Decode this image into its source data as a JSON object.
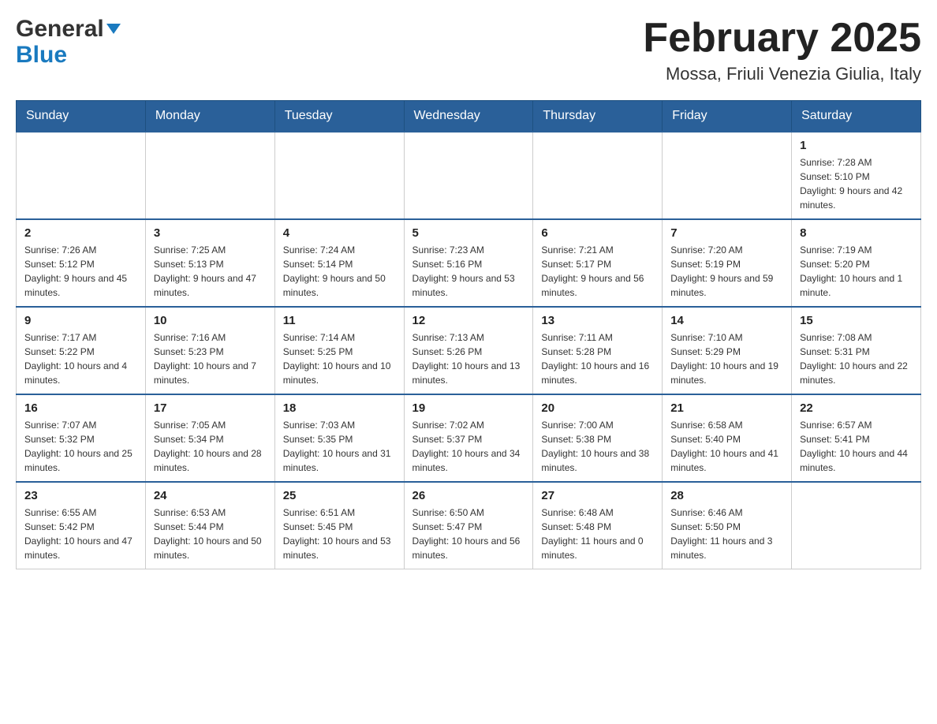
{
  "header": {
    "logo_line1": "General",
    "logo_line2": "Blue",
    "month_title": "February 2025",
    "location": "Mossa, Friuli Venezia Giulia, Italy"
  },
  "weekdays": [
    "Sunday",
    "Monday",
    "Tuesday",
    "Wednesday",
    "Thursday",
    "Friday",
    "Saturday"
  ],
  "weeks": [
    [
      {
        "day": "",
        "info": ""
      },
      {
        "day": "",
        "info": ""
      },
      {
        "day": "",
        "info": ""
      },
      {
        "day": "",
        "info": ""
      },
      {
        "day": "",
        "info": ""
      },
      {
        "day": "",
        "info": ""
      },
      {
        "day": "1",
        "info": "Sunrise: 7:28 AM\nSunset: 5:10 PM\nDaylight: 9 hours and 42 minutes."
      }
    ],
    [
      {
        "day": "2",
        "info": "Sunrise: 7:26 AM\nSunset: 5:12 PM\nDaylight: 9 hours and 45 minutes."
      },
      {
        "day": "3",
        "info": "Sunrise: 7:25 AM\nSunset: 5:13 PM\nDaylight: 9 hours and 47 minutes."
      },
      {
        "day": "4",
        "info": "Sunrise: 7:24 AM\nSunset: 5:14 PM\nDaylight: 9 hours and 50 minutes."
      },
      {
        "day": "5",
        "info": "Sunrise: 7:23 AM\nSunset: 5:16 PM\nDaylight: 9 hours and 53 minutes."
      },
      {
        "day": "6",
        "info": "Sunrise: 7:21 AM\nSunset: 5:17 PM\nDaylight: 9 hours and 56 minutes."
      },
      {
        "day": "7",
        "info": "Sunrise: 7:20 AM\nSunset: 5:19 PM\nDaylight: 9 hours and 59 minutes."
      },
      {
        "day": "8",
        "info": "Sunrise: 7:19 AM\nSunset: 5:20 PM\nDaylight: 10 hours and 1 minute."
      }
    ],
    [
      {
        "day": "9",
        "info": "Sunrise: 7:17 AM\nSunset: 5:22 PM\nDaylight: 10 hours and 4 minutes."
      },
      {
        "day": "10",
        "info": "Sunrise: 7:16 AM\nSunset: 5:23 PM\nDaylight: 10 hours and 7 minutes."
      },
      {
        "day": "11",
        "info": "Sunrise: 7:14 AM\nSunset: 5:25 PM\nDaylight: 10 hours and 10 minutes."
      },
      {
        "day": "12",
        "info": "Sunrise: 7:13 AM\nSunset: 5:26 PM\nDaylight: 10 hours and 13 minutes."
      },
      {
        "day": "13",
        "info": "Sunrise: 7:11 AM\nSunset: 5:28 PM\nDaylight: 10 hours and 16 minutes."
      },
      {
        "day": "14",
        "info": "Sunrise: 7:10 AM\nSunset: 5:29 PM\nDaylight: 10 hours and 19 minutes."
      },
      {
        "day": "15",
        "info": "Sunrise: 7:08 AM\nSunset: 5:31 PM\nDaylight: 10 hours and 22 minutes."
      }
    ],
    [
      {
        "day": "16",
        "info": "Sunrise: 7:07 AM\nSunset: 5:32 PM\nDaylight: 10 hours and 25 minutes."
      },
      {
        "day": "17",
        "info": "Sunrise: 7:05 AM\nSunset: 5:34 PM\nDaylight: 10 hours and 28 minutes."
      },
      {
        "day": "18",
        "info": "Sunrise: 7:03 AM\nSunset: 5:35 PM\nDaylight: 10 hours and 31 minutes."
      },
      {
        "day": "19",
        "info": "Sunrise: 7:02 AM\nSunset: 5:37 PM\nDaylight: 10 hours and 34 minutes."
      },
      {
        "day": "20",
        "info": "Sunrise: 7:00 AM\nSunset: 5:38 PM\nDaylight: 10 hours and 38 minutes."
      },
      {
        "day": "21",
        "info": "Sunrise: 6:58 AM\nSunset: 5:40 PM\nDaylight: 10 hours and 41 minutes."
      },
      {
        "day": "22",
        "info": "Sunrise: 6:57 AM\nSunset: 5:41 PM\nDaylight: 10 hours and 44 minutes."
      }
    ],
    [
      {
        "day": "23",
        "info": "Sunrise: 6:55 AM\nSunset: 5:42 PM\nDaylight: 10 hours and 47 minutes."
      },
      {
        "day": "24",
        "info": "Sunrise: 6:53 AM\nSunset: 5:44 PM\nDaylight: 10 hours and 50 minutes."
      },
      {
        "day": "25",
        "info": "Sunrise: 6:51 AM\nSunset: 5:45 PM\nDaylight: 10 hours and 53 minutes."
      },
      {
        "day": "26",
        "info": "Sunrise: 6:50 AM\nSunset: 5:47 PM\nDaylight: 10 hours and 56 minutes."
      },
      {
        "day": "27",
        "info": "Sunrise: 6:48 AM\nSunset: 5:48 PM\nDaylight: 11 hours and 0 minutes."
      },
      {
        "day": "28",
        "info": "Sunrise: 6:46 AM\nSunset: 5:50 PM\nDaylight: 11 hours and 3 minutes."
      },
      {
        "day": "",
        "info": ""
      }
    ]
  ]
}
